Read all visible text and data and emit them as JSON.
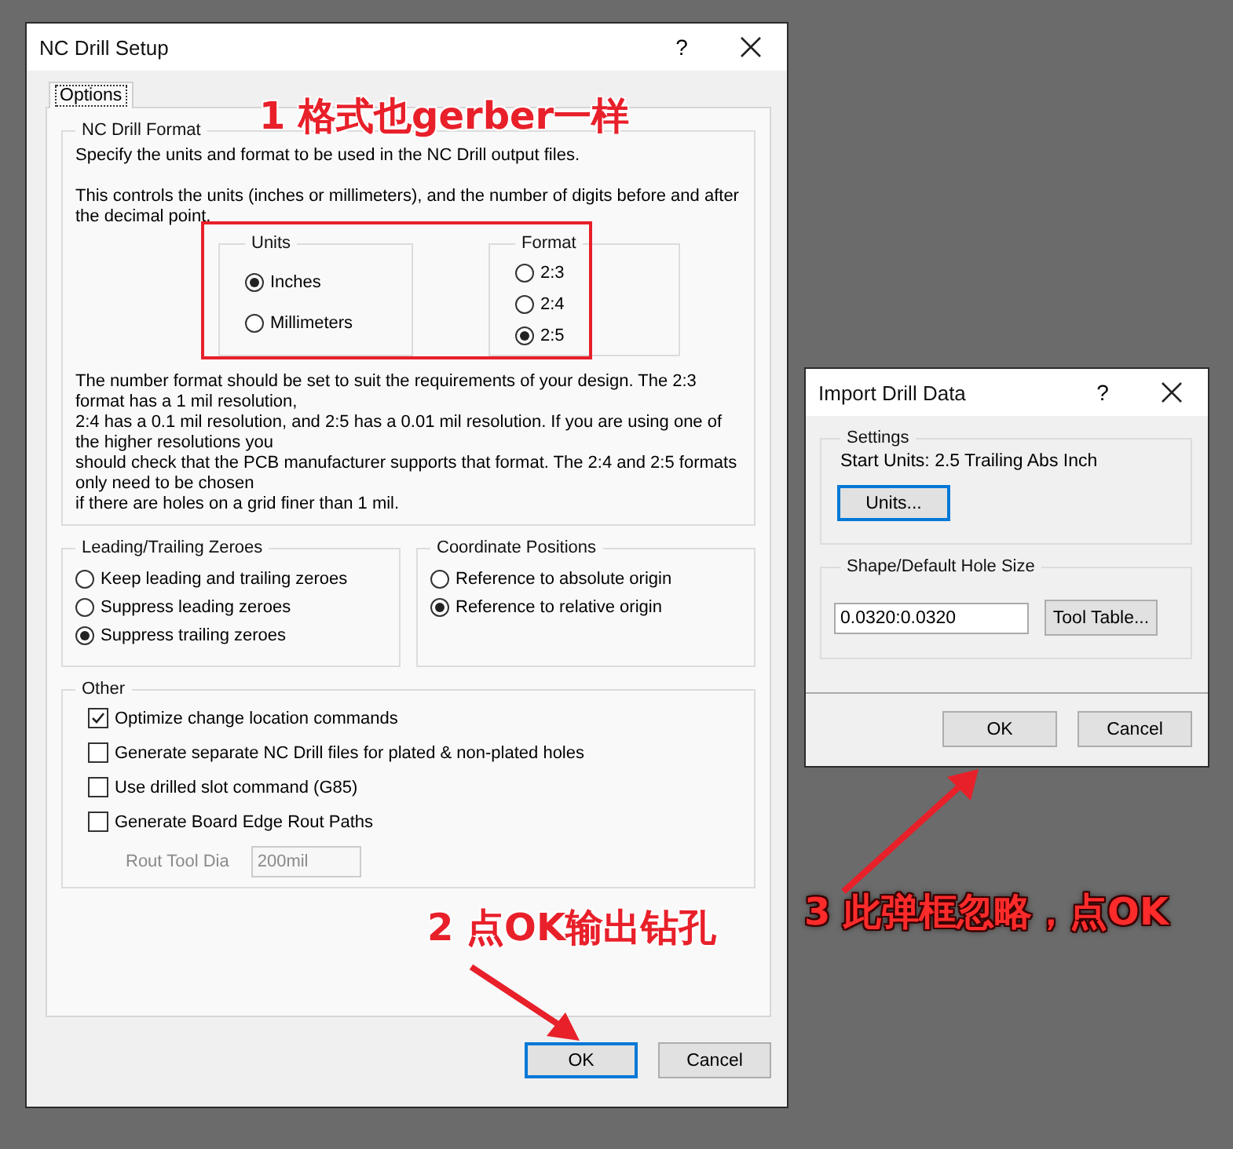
{
  "nc_drill_setup": {
    "title": "NC Drill Setup",
    "help_label": "?",
    "tabs": [
      {
        "label": "Options",
        "selected": true
      }
    ],
    "format_group": {
      "title": "NC Drill Format",
      "intro": "Specify the units and format to be used in the NC Drill output files.",
      "description": "This controls the units (inches or millimeters), and the number of digits before and after the decimal point.",
      "units": {
        "title": "Units",
        "options": [
          {
            "label": "Inches",
            "selected": true
          },
          {
            "label": "Millimeters",
            "selected": false
          }
        ]
      },
      "format": {
        "title": "Format",
        "options": [
          {
            "label": "2:3",
            "selected": false
          },
          {
            "label": "2:4",
            "selected": false
          },
          {
            "label": "2:5",
            "selected": true
          }
        ]
      },
      "notes": [
        "The number format should be set to suit the requirements of your design. The 2:3 format has a 1 mil resolution,",
        "2:4 has a 0.1 mil resolution, and 2:5 has a 0.01 mil resolution. If you are using one of the higher resolutions you",
        "should check that the PCB manufacturer supports that format. The 2:4 and 2:5 formats only need to be chosen",
        "if there are holes on a grid finer than 1 mil."
      ]
    },
    "zeroes_group": {
      "title": "Leading/Trailing Zeroes",
      "options": [
        {
          "label": "Keep leading and trailing zeroes",
          "selected": false
        },
        {
          "label": "Suppress leading zeroes",
          "selected": false
        },
        {
          "label": "Suppress trailing zeroes",
          "selected": true
        }
      ]
    },
    "coordinates_group": {
      "title": "Coordinate Positions",
      "options": [
        {
          "label": "Reference to absolute origin",
          "selected": false
        },
        {
          "label": "Reference to relative origin",
          "selected": true
        }
      ]
    },
    "other_group": {
      "title": "Other",
      "options": [
        {
          "label": "Optimize change location commands",
          "checked": true
        },
        {
          "label": "Generate separate NC Drill files for plated & non-plated holes",
          "checked": false
        },
        {
          "label": "Use drilled slot command (G85)",
          "checked": false
        },
        {
          "label": "Generate Board Edge Rout Paths",
          "checked": false
        }
      ],
      "rout_tool_dia": {
        "label": "Rout Tool Dia",
        "value": "200mil",
        "disabled": true
      }
    },
    "buttons": [
      {
        "label": "OK",
        "default": true
      },
      {
        "label": "Cancel",
        "default": false
      }
    ]
  },
  "import_drill_data": {
    "title": "Import Drill Data",
    "help_label": "?",
    "settings_group": {
      "title": "Settings",
      "text": "Start Units: 2.5 Trailing Abs Inch",
      "button": "Units..."
    },
    "hole_size_group": {
      "title": "Shape/Default Hole Size",
      "value": "0.0320:0.0320",
      "button": "Tool Table..."
    },
    "buttons": [
      {
        "label": "OK",
        "default": false
      },
      {
        "label": "Cancel",
        "default": false
      }
    ]
  },
  "annotations": [
    "1 格式也gerber一样",
    "2 点OK输出钻孔",
    "3 此弹框忽略，点OK"
  ]
}
